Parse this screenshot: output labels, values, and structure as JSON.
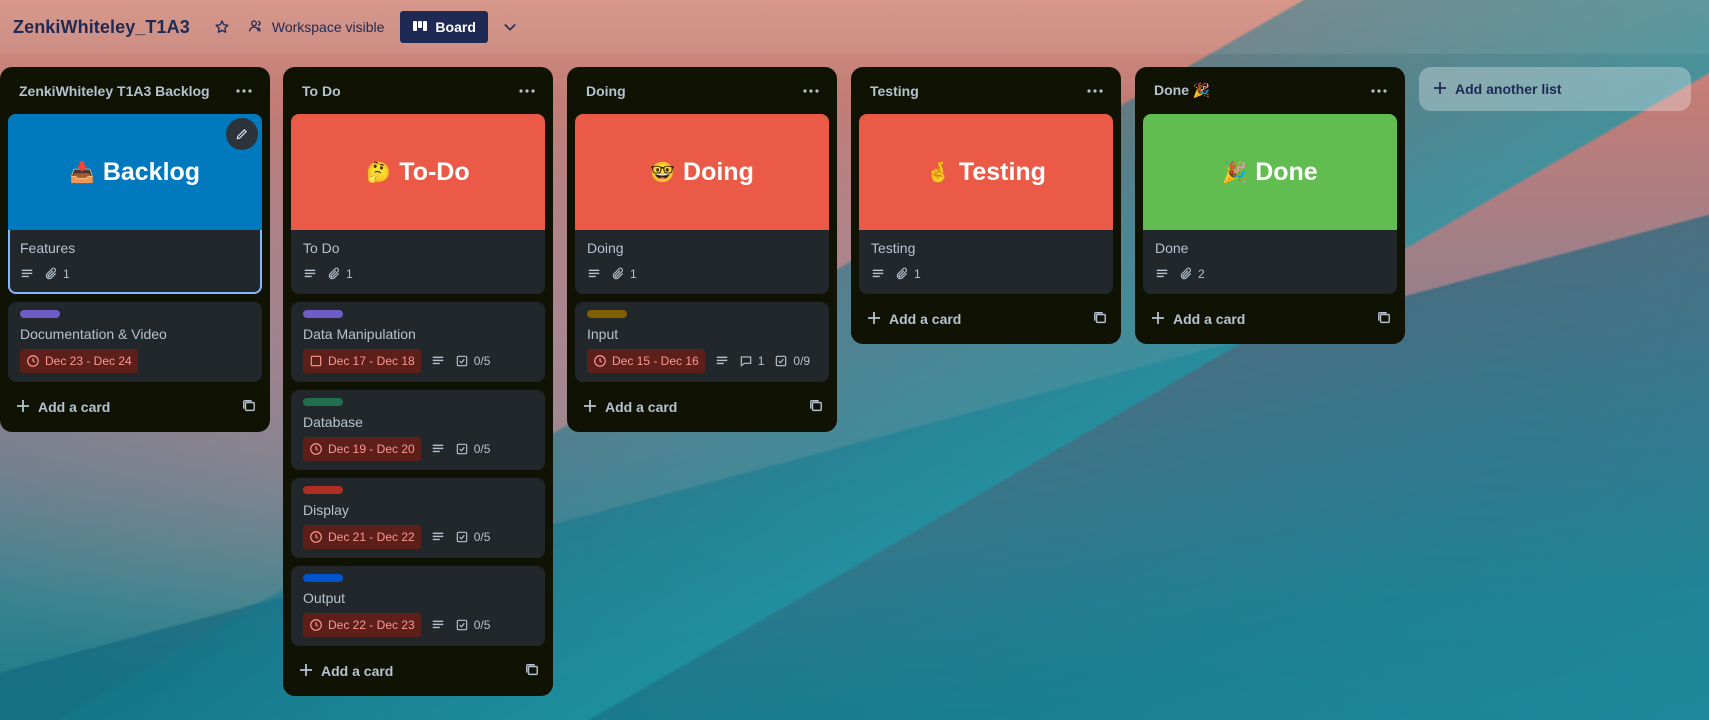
{
  "board": {
    "title": "ZenkiWhiteley_T1A3",
    "visibility_label": "Workspace visible",
    "view_label": "Board"
  },
  "colors": {
    "cover_blue": "#0079bf",
    "cover_red": "#eb5a46",
    "cover_green": "#61bd4f",
    "label_purple": "#6e5dc6",
    "label_green": "#216e4e",
    "label_red": "#ae2e24",
    "label_blue": "#0055cc",
    "label_yellow": "#7f5f01"
  },
  "lists": [
    {
      "title": "ZenkiWhiteley T1A3 Backlog",
      "add_card_label": "Add a card",
      "cards": [
        {
          "cover_emoji": "📥",
          "cover_text": "Backlog",
          "title": "Features",
          "attachments": "1"
        },
        {
          "title": "Documentation & Video",
          "due": "Dec 23 - Dec 24"
        }
      ]
    },
    {
      "title": "To Do",
      "add_card_label": "Add a card",
      "cards": [
        {
          "cover_emoji": "🤔",
          "cover_text": "To-Do",
          "title": "To Do",
          "attachments": "1"
        },
        {
          "title": "Data Manipulation",
          "due": "Dec 17 - Dec 18",
          "checklist": "0/5"
        },
        {
          "title": "Database",
          "due": "Dec 19 - Dec 20",
          "checklist": "0/5"
        },
        {
          "title": "Display",
          "due": "Dec 21 - Dec 22",
          "checklist": "0/5"
        },
        {
          "title": "Output",
          "due": "Dec 22 - Dec 23",
          "checklist": "0/5"
        }
      ]
    },
    {
      "title": "Doing",
      "add_card_label": "Add a card",
      "cards": [
        {
          "cover_emoji": "🤓",
          "cover_text": "Doing",
          "title": "Doing",
          "attachments": "1"
        },
        {
          "title": "Input",
          "due": "Dec 15 - Dec 16",
          "comments": "1",
          "checklist": "0/9"
        }
      ]
    },
    {
      "title": "Testing",
      "add_card_label": "Add a card",
      "cards": [
        {
          "cover_emoji": "🤞",
          "cover_text": "Testing",
          "title": "Testing",
          "attachments": "1"
        }
      ]
    },
    {
      "title": "Done 🎉",
      "add_card_label": "Add a card",
      "cards": [
        {
          "cover_emoji": "🎉",
          "cover_text": "Done",
          "title": "Done",
          "attachments": "2"
        }
      ]
    }
  ],
  "add_list_label": "Add another list"
}
